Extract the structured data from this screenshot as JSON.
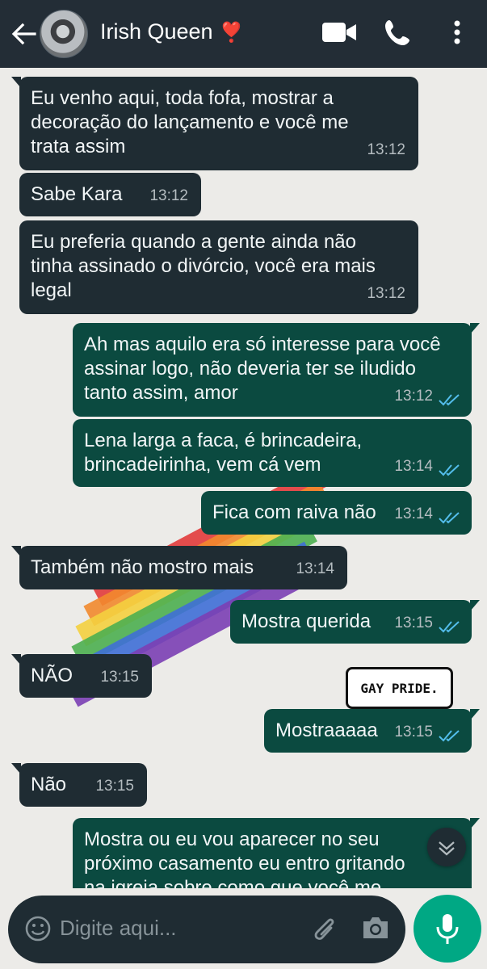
{
  "header": {
    "contact_name": "Irish Queen",
    "emoji": "❣️",
    "icons": [
      "back-arrow-icon",
      "video-call-icon",
      "voice-call-icon",
      "more-options-icon"
    ]
  },
  "messages": [
    {
      "dir": "in",
      "text": "Eu venho aqui, toda fofa, mostrar a\ndecoração do lançamento e você me\ntrata assim",
      "time": "13:12"
    },
    {
      "dir": "in",
      "text": "Sabe Kara",
      "time": "13:12"
    },
    {
      "dir": "in",
      "text": "Eu preferia quando a gente ainda não\ntinha assinado o divórcio, você era mais\nlegal",
      "time": "13:12"
    },
    {
      "dir": "out",
      "text": "Ah mas aquilo era só interesse para você\nassinar logo, não deveria ter se iludido\ntanto assim, amor",
      "time": "13:12",
      "status": "read"
    },
    {
      "dir": "out",
      "text": "Lena larga a faca, é brincadeira,\nbrincadeirinha, vem cá vem",
      "time": "13:14",
      "status": "read"
    },
    {
      "dir": "out",
      "text": "Fica com raiva não",
      "time": "13:14",
      "status": "read"
    },
    {
      "dir": "in",
      "text": "Também não mostro mais",
      "time": "13:14"
    },
    {
      "dir": "out",
      "text": "Mostra querida",
      "time": "13:15",
      "status": "read"
    },
    {
      "dir": "in",
      "text": "NÃO",
      "time": "13:15"
    },
    {
      "dir": "out",
      "text": "Mostraaaaa",
      "time": "13:15",
      "status": "read"
    },
    {
      "dir": "in",
      "text": "Não",
      "time": "13:15"
    },
    {
      "dir": "out",
      "text": "Mostra ou eu vou aparecer no seu\npróximo casamento eu entro gritando\nna igreja sobre como que você me",
      "time": "",
      "status": ""
    }
  ],
  "wallpaper": {
    "sticker_text": "GAY PRIDE."
  },
  "composer": {
    "placeholder": "Digite aqui...",
    "icons": [
      "emoji-icon",
      "attach-icon",
      "camera-icon",
      "mic-icon"
    ]
  },
  "colors": {
    "header_bg": "#232d36",
    "incoming_bubble": "#1f2c33",
    "outgoing_bubble": "#0b4a40",
    "accent": "#00a884",
    "read_ticks": "#53bdeb"
  }
}
